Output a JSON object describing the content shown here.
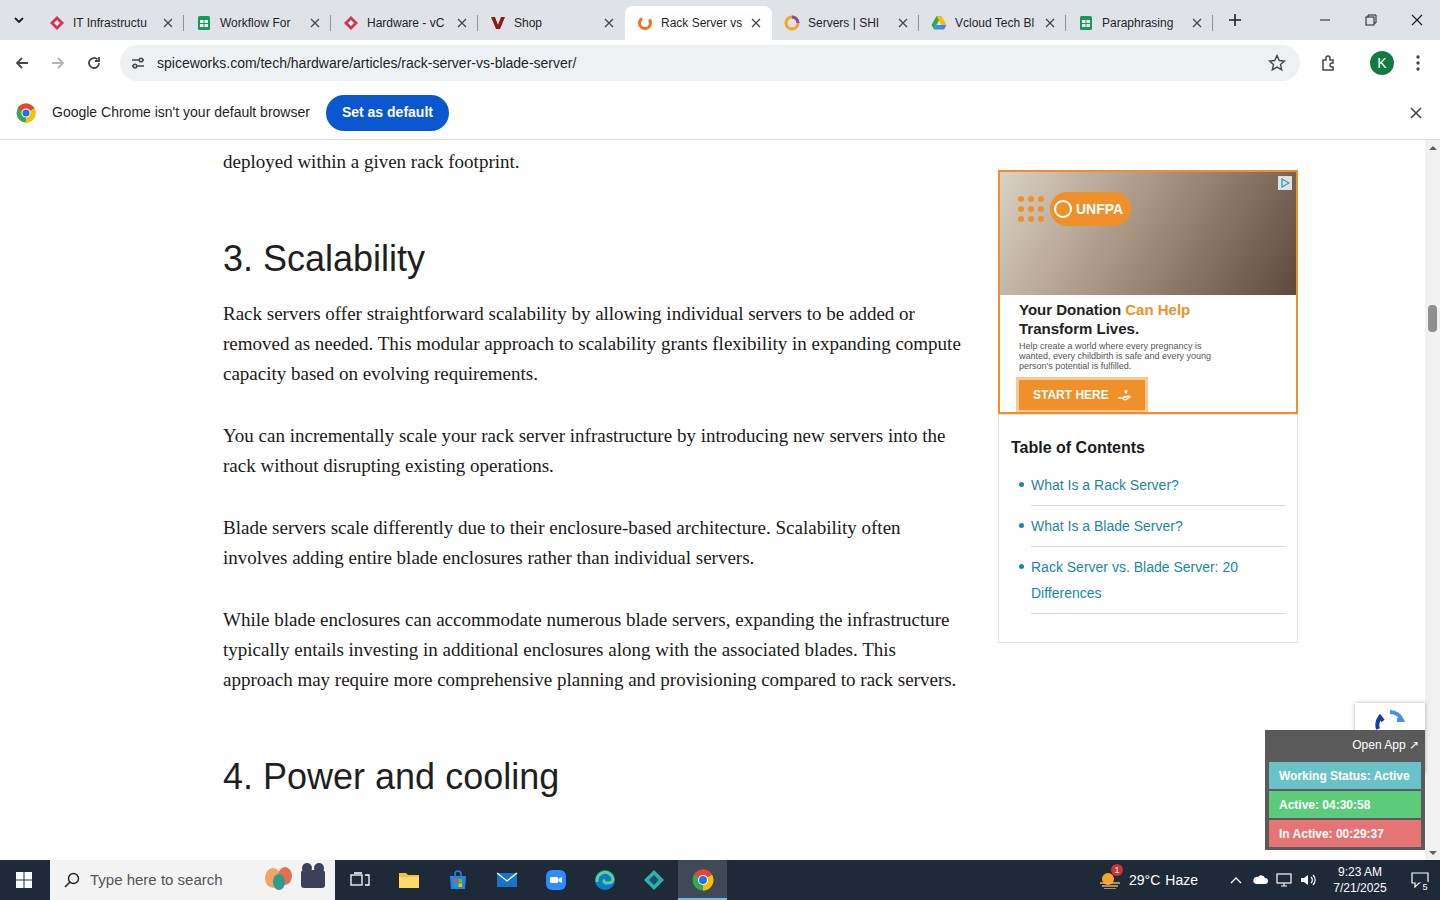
{
  "browser": {
    "tabs": [
      {
        "label": "IT Infrastructu",
        "kind": "vcloud",
        "selected": false
      },
      {
        "label": "Workflow For",
        "kind": "sheets",
        "selected": false
      },
      {
        "label": "Hardware - vC",
        "kind": "vcloud",
        "selected": false
      },
      {
        "label": "Shop",
        "kind": "v",
        "selected": false
      },
      {
        "label": "Rack Server vs",
        "kind": "spiceworks",
        "selected": true
      },
      {
        "label": "Servers | SHI",
        "kind": "ring",
        "selected": false
      },
      {
        "label": "Vcloud Tech Bl",
        "kind": "drive",
        "selected": false
      },
      {
        "label": "Paraphrasing",
        "kind": "sheets",
        "selected": false
      }
    ],
    "address": "spiceworks.com/tech/hardware/articles/rack-server-vs-blade-server/",
    "bookmarked": false,
    "profile": "K"
  },
  "infobar": {
    "message": "Google Chrome isn't your default browser",
    "button": "Set as default"
  },
  "article": {
    "lead": "deployed within a given rack footprint.",
    "sections": [
      {
        "heading": "3. Scalability",
        "paragraphs": [
          "Rack servers offer straightforward scalability by allowing individual servers to be added or removed as needed. This modular approach to scalability grants flexibility in expanding compute capacity based on evolving requirements.",
          "You can incrementally scale your rack server infrastructure by introducing new servers into the rack without disrupting existing operations.",
          "Blade servers scale differently due to their enclosure-based architecture. Scalability often involves adding entire blade enclosures rather than individual servers.",
          "While blade enclosures can accommodate numerous blade servers, expanding the infrastructure typically entails investing in additional enclosures along with the associated blades. This approach may require more comprehensive planning and provisioning compared to rack servers."
        ]
      },
      {
        "heading": "4. Power and cooling",
        "paragraphs": []
      }
    ]
  },
  "ad": {
    "logo": "UNFPA",
    "headline": "Your Donation",
    "headline_highlight": "Can Help",
    "subheadline": "Transform Lives.",
    "body": "Help create a world where every pregnancy is wanted, every childbirth is safe and every young person's potential is fulfilled.",
    "button": "START HERE"
  },
  "toc": {
    "title": "Table of Contents",
    "items": [
      "What Is a Rack Server?",
      "What Is a Blade Server?",
      "Rack Server vs. Blade Server: 20 Differences"
    ]
  },
  "widget": {
    "open_app": "Open App ↗",
    "rows": [
      {
        "text": "Working Status: Active",
        "color": "#69c2c8"
      },
      {
        "text": "Active: 04:30:58",
        "color": "#5ccb7c"
      },
      {
        "text": "In Active: 00:29:37",
        "color": "#e67474"
      }
    ]
  },
  "taskbar": {
    "search_placeholder": "Type here to search",
    "apps": [
      {
        "kind": "taskview",
        "selected": false
      },
      {
        "kind": "explorer",
        "selected": false
      },
      {
        "kind": "store",
        "selected": false
      },
      {
        "kind": "mail",
        "selected": false
      },
      {
        "kind": "zoom",
        "selected": false
      },
      {
        "kind": "edge",
        "selected": false
      },
      {
        "kind": "app",
        "selected": false
      },
      {
        "kind": "chrome",
        "selected": true
      }
    ],
    "weather": {
      "badge": "1",
      "temp": "29°C",
      "condition": "Haze"
    },
    "time": "9:23 AM",
    "date": "7/21/2025",
    "notifications": "5"
  }
}
